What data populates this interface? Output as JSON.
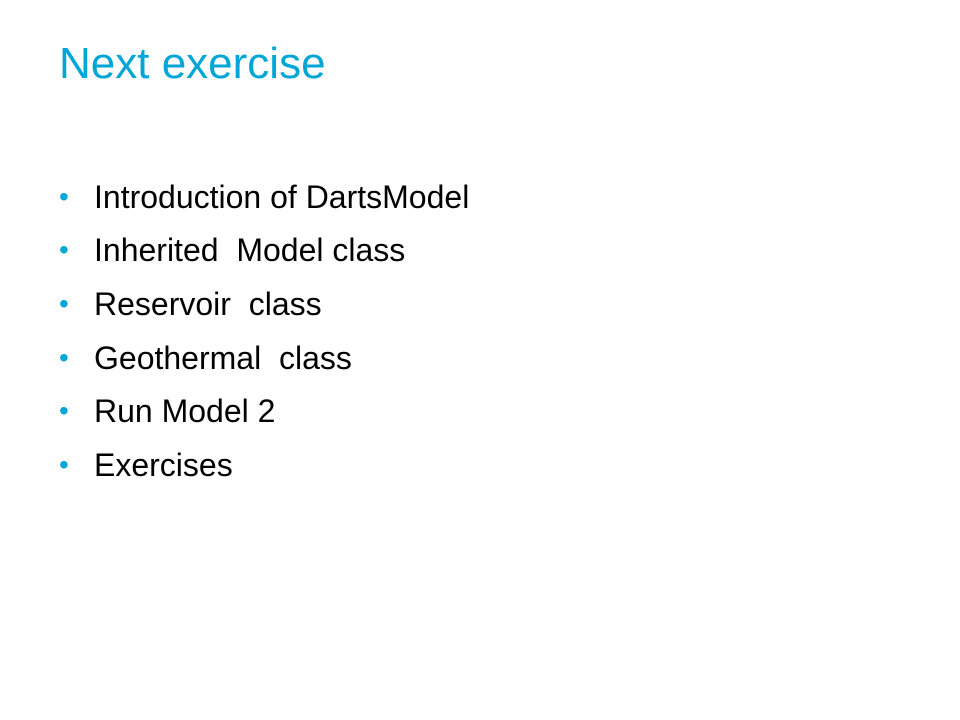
{
  "slide": {
    "title": "Next exercise",
    "bullets": [
      "Introduction of DartsModel",
      "Inherited  Model class",
      "Reservoir  class",
      "Geothermal  class",
      "Run Model 2",
      "Exercises"
    ],
    "bullet_symbol": "•",
    "colors": {
      "title": "#00a6d6",
      "bullet": "#00a6d6",
      "text": "#000000",
      "background": "#ffffff"
    }
  }
}
